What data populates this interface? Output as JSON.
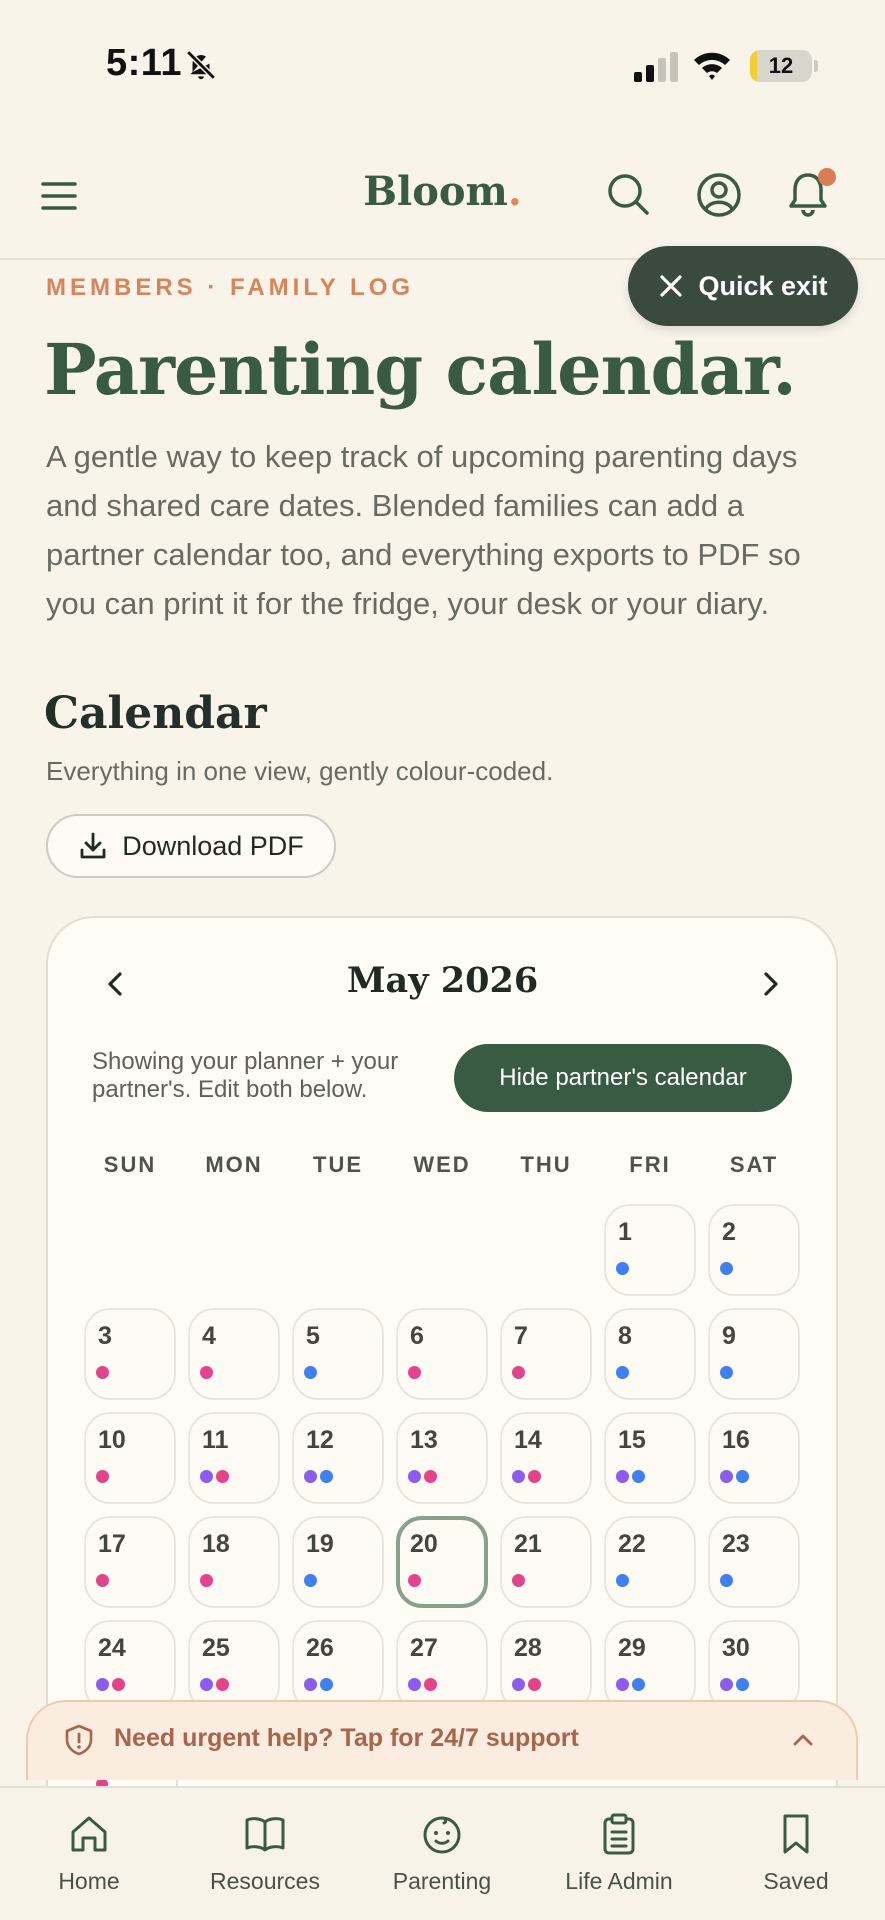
{
  "status_bar": {
    "time": "5:11",
    "battery": "12",
    "battery_level": 0.12
  },
  "header": {
    "logo": "Bloom",
    "logo_dot": "."
  },
  "quick_exit": {
    "label": "Quick exit"
  },
  "page": {
    "eyebrow": "MEMBERS · FAMILY LOG",
    "title": "Parenting calendar.",
    "intro": "A gentle way to keep track of upcoming parenting days and shared care dates. Blended families can add a partner calendar too, and everything exports to PDF so you can print it for the fridge, your desk or your diary."
  },
  "calendar_section": {
    "title": "Calendar",
    "subtitle": "Everything in one view, gently colour-coded.",
    "download_label": "Download PDF"
  },
  "calendar": {
    "month": "May 2026",
    "partner_note": "Showing your planner + your partner's. Edit both below.",
    "hide_partner_label": "Hide partner's calendar",
    "weekdays": [
      "SUN",
      "MON",
      "TUE",
      "WED",
      "THU",
      "FRI",
      "SAT"
    ],
    "first_weekday_index": 5,
    "today": 20,
    "dot_colors": {
      "pink": "#e2438a",
      "blue": "#3f7ff0",
      "purple": "#8c5cf0"
    },
    "days": [
      {
        "n": "1",
        "dots": [
          "blue"
        ]
      },
      {
        "n": "2",
        "dots": [
          "blue"
        ]
      },
      {
        "n": "3",
        "dots": [
          "pink"
        ]
      },
      {
        "n": "4",
        "dots": [
          "pink"
        ]
      },
      {
        "n": "5",
        "dots": [
          "blue"
        ]
      },
      {
        "n": "6",
        "dots": [
          "pink"
        ]
      },
      {
        "n": "7",
        "dots": [
          "pink"
        ]
      },
      {
        "n": "8",
        "dots": [
          "blue"
        ]
      },
      {
        "n": "9",
        "dots": [
          "blue"
        ]
      },
      {
        "n": "10",
        "dots": [
          "pink"
        ]
      },
      {
        "n": "11",
        "dots": [
          "purple",
          "pink"
        ]
      },
      {
        "n": "12",
        "dots": [
          "purple",
          "blue"
        ]
      },
      {
        "n": "13",
        "dots": [
          "purple",
          "pink"
        ]
      },
      {
        "n": "14",
        "dots": [
          "purple",
          "pink"
        ]
      },
      {
        "n": "15",
        "dots": [
          "purple",
          "blue"
        ]
      },
      {
        "n": "16",
        "dots": [
          "purple",
          "blue"
        ]
      },
      {
        "n": "17",
        "dots": [
          "pink"
        ]
      },
      {
        "n": "18",
        "dots": [
          "pink"
        ]
      },
      {
        "n": "19",
        "dots": [
          "blue"
        ]
      },
      {
        "n": "20",
        "dots": [
          "pink"
        ]
      },
      {
        "n": "21",
        "dots": [
          "pink"
        ]
      },
      {
        "n": "22",
        "dots": [
          "blue"
        ]
      },
      {
        "n": "23",
        "dots": [
          "blue"
        ]
      },
      {
        "n": "24",
        "dots": [
          "purple",
          "pink"
        ]
      },
      {
        "n": "25",
        "dots": [
          "purple",
          "pink"
        ]
      },
      {
        "n": "26",
        "dots": [
          "purple",
          "blue"
        ]
      },
      {
        "n": "27",
        "dots": [
          "purple",
          "pink"
        ]
      },
      {
        "n": "28",
        "dots": [
          "purple",
          "pink"
        ]
      },
      {
        "n": "29",
        "dots": [
          "purple",
          "blue"
        ]
      },
      {
        "n": "30",
        "dots": [
          "purple",
          "blue"
        ]
      }
    ]
  },
  "urgent": {
    "label": "Need urgent help? Tap for 24/7 support"
  },
  "bottom_nav": [
    {
      "label": "Home",
      "icon": "home-icon"
    },
    {
      "label": "Resources",
      "icon": "book-icon"
    },
    {
      "label": "Parenting",
      "icon": "baby-face-icon"
    },
    {
      "label": "Life Admin",
      "icon": "clipboard-icon"
    },
    {
      "label": "Saved",
      "icon": "bookmark-icon"
    }
  ],
  "colors": {
    "brand_green": "#3a5b43",
    "accent_orange": "#d9835a",
    "background": "#f8f4ea",
    "dark_button": "#3b4a3f"
  }
}
